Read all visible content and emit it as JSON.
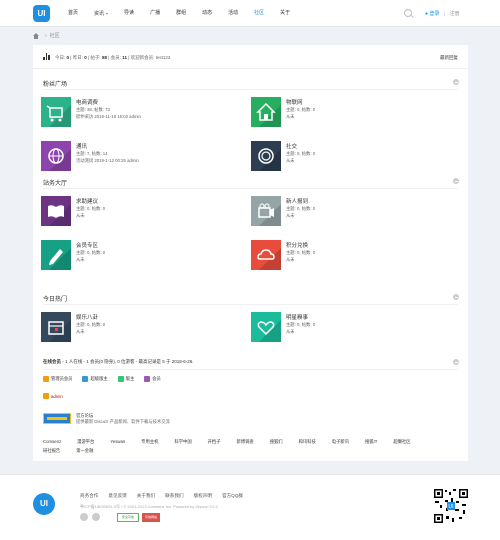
{
  "header": {
    "logo_text": "UI",
    "nav": [
      {
        "label": "首页",
        "active": false,
        "dropdown": false
      },
      {
        "label": "资讯",
        "active": false,
        "dropdown": true
      },
      {
        "label": "导读",
        "active": false,
        "dropdown": false
      },
      {
        "label": "广播",
        "active": false,
        "dropdown": false
      },
      {
        "label": "群组",
        "active": false,
        "dropdown": false
      },
      {
        "label": "动态",
        "active": false,
        "dropdown": false
      },
      {
        "label": "活动",
        "active": false,
        "dropdown": false
      },
      {
        "label": "社区",
        "active": true,
        "dropdown": false
      },
      {
        "label": "关于",
        "active": false,
        "dropdown": false
      }
    ],
    "dropdown_arrow": "▾",
    "login_label": "登录",
    "separator": "|",
    "register_label": "注册"
  },
  "breadcrumb": {
    "separator": "›",
    "current": "社区"
  },
  "stats": {
    "today_label": "今日:",
    "today": "0",
    "yesterday_label": "昨日:",
    "yesterday": "0",
    "posts_label": "帖子:",
    "posts": "88",
    "members_label": "会员:",
    "members": "11",
    "welcome_label": "欢迎新会员:",
    "newest_member": "test123",
    "newest_reply_label": "最新回复"
  },
  "sections": [
    {
      "title": "粉丝广场",
      "forums": [
        {
          "name": "电商调费",
          "stats": "主题: 38, 帖数: 73",
          "last": "欲仲采访 2019-11-18 15:02 admin",
          "color": "#2db38a",
          "icon": "cart-icon"
        },
        {
          "name": "物联网",
          "stats": "主题: 0, 帖数: 0",
          "last": "从未",
          "color": "#27ae60",
          "icon": "house-icon"
        },
        {
          "name": "通讯",
          "stats": "主题: 7, 帖数: 14",
          "last": "活动测试 2019-1-12 00:25 admin",
          "color": "#8e44ad",
          "icon": "globe-icon"
        },
        {
          "name": "社交",
          "stats": "主题: 0, 帖数: 0",
          "last": "从未",
          "color": "#2c3e50",
          "icon": "ring-icon"
        }
      ]
    },
    {
      "title": "站务大厅",
      "forums": [
        {
          "name": "求助建议",
          "stats": "主题: 0, 帖数: 0",
          "last": "从未",
          "color": "#6c3483",
          "icon": "book-icon"
        },
        {
          "name": "新人报到",
          "stats": "主题: 0, 帖数: 0",
          "last": "从未",
          "color": "#95a5a6",
          "icon": "camera-icon"
        },
        {
          "name": "会员专区",
          "stats": "主题: 0, 帖数: 0",
          "last": "从未",
          "color": "#16a085",
          "icon": "pencil-icon"
        },
        {
          "name": "积分兑换",
          "stats": "主题: 0, 帖数: 0",
          "last": "从未",
          "color": "#e74c3c",
          "icon": "cloud-icon"
        }
      ]
    },
    {
      "title": "今日热门",
      "forums": [
        {
          "name": "娱乐八卦",
          "stats": "主题: 0, 帖数: 0",
          "last": "从未",
          "color": "#34495e",
          "icon": "calendar-icon"
        },
        {
          "name": "明星糗事",
          "stats": "主题: 0, 帖数: 0",
          "last": "从未",
          "color": "#1abc9c",
          "icon": "heart-icon"
        }
      ]
    }
  ],
  "online": {
    "label": "在线会员",
    "text": "- 1 人在线 - 1 会员(0 隐身), 0 位游客 - 最高记录是 5 于 2018-6-26."
  },
  "legend": [
    {
      "label": "管理员会员",
      "color": "#f39c12"
    },
    {
      "label": "超级版主",
      "color": "#3498db"
    },
    {
      "label": "版主",
      "color": "#2ecc71"
    },
    {
      "label": "会员",
      "color": "#9b59b6"
    }
  ],
  "admin_user": "admin",
  "banner": {
    "title": "官方论坛",
    "desc": "提供最新 Discuz! 产品新闻、软件下载与技术交流"
  },
  "links_row1": [
    "Comsenz",
    "漫游平台",
    "Yeswan",
    "专用主机",
    "科学中国",
    "开档子",
    "新博调查",
    "搜狐们",
    "和讯科技",
    "电子新讯",
    "搜狐IT",
    "超懒社区"
  ],
  "links_row2": [
    "研社报告",
    "第一金融"
  ],
  "footer": {
    "logo_text": "UI",
    "links": [
      "商务合作",
      "意见反馈",
      "关于我们",
      "联系我们",
      "版权声明",
      "官方QQ群"
    ],
    "copyright": "粤ICP备18030001-3号 / © 2001-2013 Comsenz Inc. Powered by Discuz! X3.2",
    "badge1": "安全可信",
    "badge2": "可信网站"
  }
}
